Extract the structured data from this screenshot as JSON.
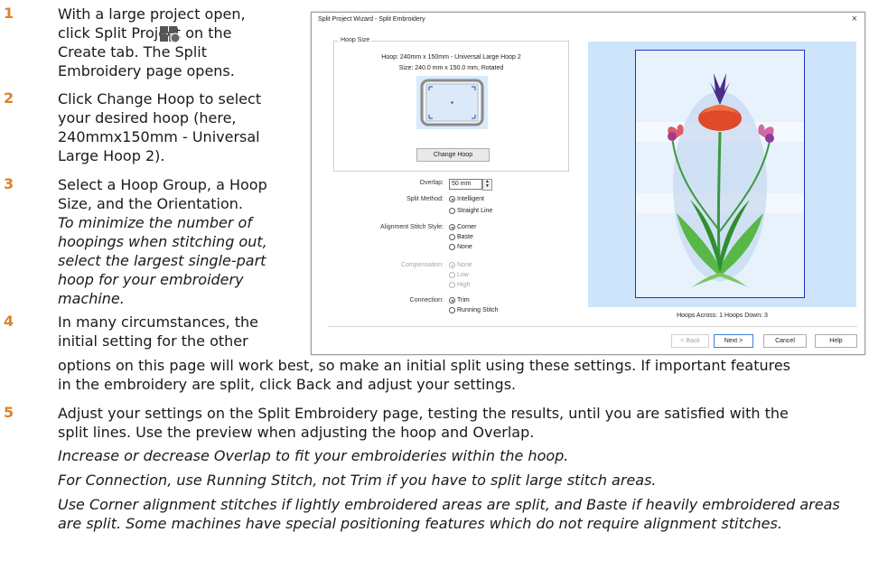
{
  "steps": [
    {
      "num": "1",
      "lines": [
        "With a large project open,",
        "click Split Project  on the",
        "Create tab. The Split",
        "Embroidery page opens."
      ]
    },
    {
      "num": "2",
      "lines": [
        "Click Change Hoop to select",
        "your desired hoop (here,",
        "240mmx150mm - Universal",
        "Large Hoop 2)."
      ]
    },
    {
      "num": "3",
      "lines": [
        "Select a Hoop Group, a Hoop",
        "Size, and the Orientation."
      ],
      "italic": [
        "To minimize the number of",
        "hoopings when stitching out,",
        "select the largest single-part",
        "hoop for your embroidery",
        "machine."
      ]
    },
    {
      "num": "4",
      "lines": [
        "In many circumstances, the",
        "initial setting for the other",
        "options on this page will work best, so make an initial split using these settings. If important features",
        "in the embroidery are split, click Back and adjust your settings."
      ]
    },
    {
      "num": "5",
      "lines": [
        "Adjust your settings on the Split Embroidery page, testing the results, until you are satisfied with the",
        "split lines. Use the preview when adjusting the hoop and Overlap."
      ],
      "italic": [
        "Increase or decrease Overlap to fit your embroideries within the hoop.",
        "For Connection, use Running Stitch, not Trim if you have to split large stitch areas.",
        "Use Corner alignment stitches if lightly embroidered areas are split, and Baste if heavily embroidered areas",
        "are split. Some machines have special positioning features which do not require alignment stitches."
      ]
    }
  ],
  "dialog": {
    "title": "Split Project Wizard - Split Embroidery",
    "close": "×",
    "hoop_size_legend": "Hoop Size",
    "hoop_line1": "Hoop: 240mm x 150mm - Universal Large Hoop 2",
    "hoop_line2": "Size: 240.0 mm x 150.0 mm, Rotated",
    "change_hoop": "Change Hoop",
    "overlap_label": "Overlap:",
    "overlap_value": "50 mm",
    "split_method_label": "Split Method:",
    "split_method_options": [
      "Intelligent",
      "Straight Line"
    ],
    "alignment_label": "Alignment Stitch Style:",
    "alignment_options": [
      "Corner",
      "Baste",
      "None"
    ],
    "compensation_label": "Compensation:",
    "compensation_options": [
      "None",
      "Low",
      "High"
    ],
    "connection_label": "Connection:",
    "connection_options": [
      "Trim",
      "Running Stitch"
    ],
    "hoops_status": "Hoops Across: 1  Hoops Down: 3",
    "buttons": {
      "back": "< Back",
      "next": "Next >",
      "cancel": "Cancel",
      "help": "Help"
    }
  },
  "colors": {
    "accent": "#e0812a",
    "preview_bg": "#cde4fb",
    "hoop_outline": "#1f35c4"
  },
  "icons": {
    "split_project": "split-project-icon"
  }
}
